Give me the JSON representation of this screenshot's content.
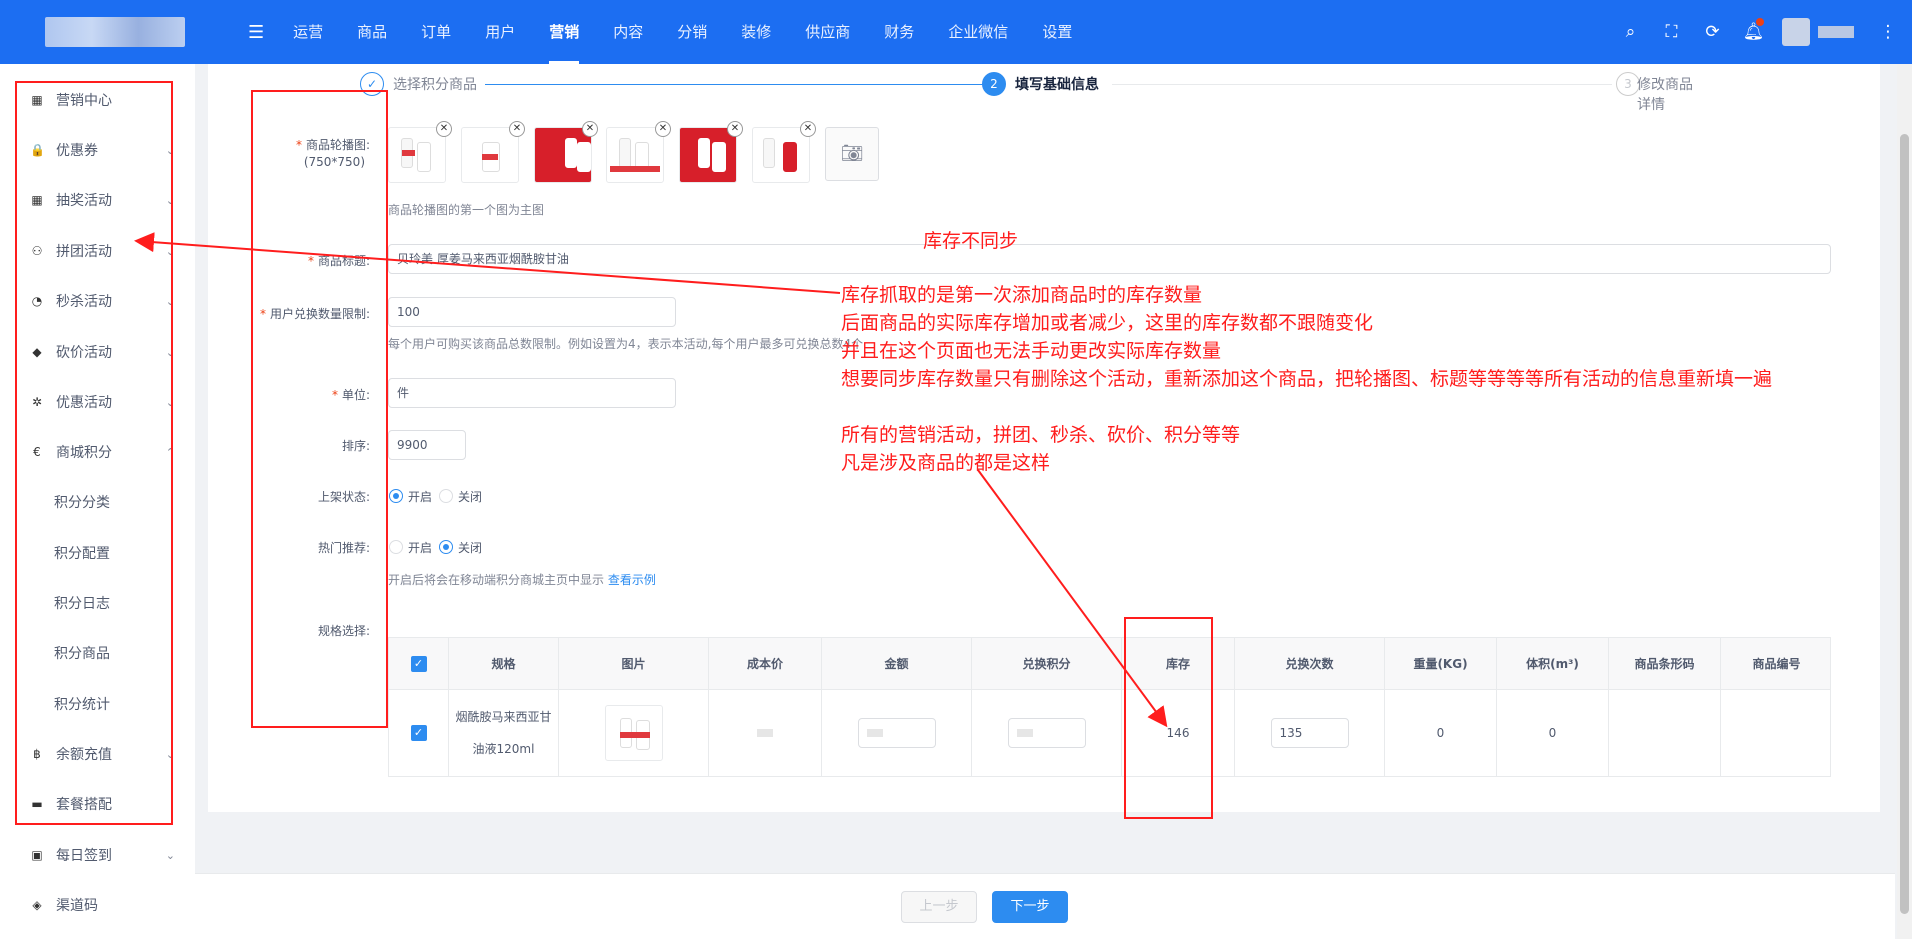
{
  "topbar": {
    "nav": [
      "运营",
      "商品",
      "订单",
      "用户",
      "营销",
      "内容",
      "分销",
      "装修",
      "供应商",
      "财务",
      "企业微信",
      "设置"
    ],
    "active_nav": "营销",
    "icons": [
      "search-icon",
      "fullscreen-icon",
      "refresh-icon",
      "bell-icon",
      "more-icon"
    ]
  },
  "sidebar": {
    "items": [
      {
        "label": "营销中心",
        "icon": "▦"
      },
      {
        "label": "优惠券",
        "icon": "🔒",
        "arrow": "⌄"
      },
      {
        "label": "抽奖活动",
        "icon": "▦",
        "arrow": "⌄"
      },
      {
        "label": "拼团活动",
        "icon": "⚇",
        "arrow": "⌄"
      },
      {
        "label": "秒杀活动",
        "icon": "◔",
        "arrow": "⌄"
      },
      {
        "label": "砍价活动",
        "icon": "◆",
        "arrow": "⌄"
      },
      {
        "label": "优惠活动",
        "icon": "✲",
        "arrow": "⌄"
      },
      {
        "label": "商城积分",
        "icon": "€",
        "arrow": "⌃"
      },
      {
        "label": "积分分类",
        "sub": true
      },
      {
        "label": "积分配置",
        "sub": true
      },
      {
        "label": "积分日志",
        "sub": true
      },
      {
        "label": "积分商品",
        "sub": true
      },
      {
        "label": "积分统计",
        "sub": true
      },
      {
        "label": "余额充值",
        "icon": "฿",
        "arrow": "⌄"
      },
      {
        "label": "套餐搭配",
        "icon": "▬"
      },
      {
        "label": "每日签到",
        "icon": "▣",
        "arrow": "⌄"
      },
      {
        "label": "渠道码",
        "icon": "◈"
      }
    ]
  },
  "steps": [
    {
      "num": "✓",
      "label": "选择积分商品"
    },
    {
      "num": "2",
      "label": "填写基础信息"
    },
    {
      "num": "3",
      "label": "修改商品详情"
    }
  ],
  "form": {
    "carousel_label": "商品轮播图:",
    "carousel_size": "(750*750)",
    "carousel_hint": "商品轮播图的第一个图为主图",
    "title_label": "商品标题:",
    "title_value": "贝玲美 厚姜马来西亚烟酰胺甘油",
    "limit_label": "用户兑换数量限制:",
    "limit_value": "100",
    "limit_hint": "每个用户可购买该商品总数限制。例如设置为4，表示本活动,每个用户最多可兑换总数4个",
    "unit_label": "单位:",
    "unit_value": "件",
    "sort_label": "排序:",
    "sort_value": "9900",
    "status_label": "上架状态:",
    "status_on": "开启",
    "status_off": "关闭",
    "hot_label": "热门推荐:",
    "hot_on": "开启",
    "hot_off": "关闭",
    "hot_hint": "开启后将会在移动端积分商城主页中显示",
    "hot_link": "查看示例",
    "spec_label": "规格选择:"
  },
  "table": {
    "headers": [
      "规格",
      "图片",
      "成本价",
      "金额",
      "兑换积分",
      "库存",
      "兑换次数",
      "重量(KG)",
      "体积(m³)",
      "商品条形码",
      "商品编号"
    ],
    "row": {
      "spec_line1": "烟酰胺马来西亚甘",
      "spec_line2": "油液120ml",
      "stock": "146",
      "times": "135",
      "weight": "0",
      "volume": "0"
    }
  },
  "buttons": {
    "prev": "上一步",
    "next": "下一步"
  },
  "annotation": {
    "title": "库存不同步",
    "lines": [
      "库存抓取的是第一次添加商品时的库存数量",
      "后面商品的实际库存增加或者减少，这里的库存数都不跟随变化",
      "并且在这个页面也无法手动更改实际库存数量",
      "想要同步库存数量只有删除这个活动，重新添加这个商品，把轮播图、标题等等等等所有活动的信息重新填一遍"
    ],
    "lines2": [
      "所有的营销活动，拼团、秒杀、砍价、积分等等",
      "凡是涉及商品的都是这样"
    ],
    "color": "#ff1d1d"
  }
}
